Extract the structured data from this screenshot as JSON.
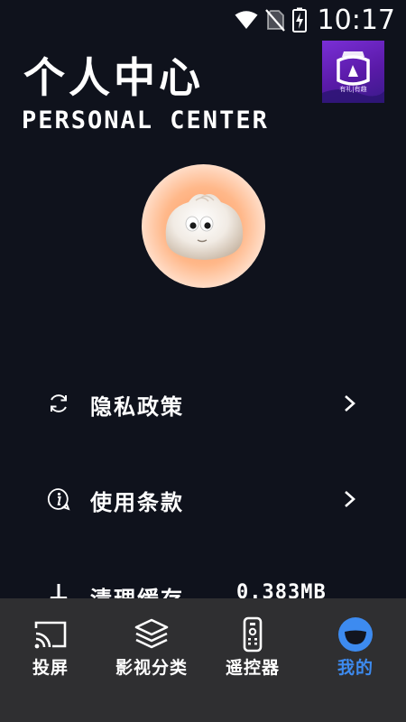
{
  "status_bar": {
    "time": "10:17",
    "icons": [
      "wifi-icon",
      "no-sim-icon",
      "battery-charging-icon"
    ]
  },
  "header": {
    "title": "个人中心",
    "subtitle": "PERSONAL CENTER",
    "logo_caption": "有礼|有趣"
  },
  "avatar": {
    "icon": "steamed-bun-avatar"
  },
  "menu": {
    "items": [
      {
        "label": "隐私政策",
        "icon": "refresh-icon",
        "arrow": "chevron-right-icon"
      },
      {
        "label": "使用条款",
        "icon": "info-icon",
        "arrow": "chevron-right-icon"
      },
      {
        "label": "清理缓存",
        "icon": "broom-icon",
        "value": "0.383MB"
      }
    ]
  },
  "bottom_nav": {
    "items": [
      {
        "label": "投屏",
        "icon": "cast-icon"
      },
      {
        "label": "影视分类",
        "icon": "layers-icon"
      },
      {
        "label": "遥控器",
        "icon": "remote-icon"
      },
      {
        "label": "我的",
        "icon": "profile-smile-icon",
        "active": true
      }
    ]
  },
  "colors": {
    "background": "#0f121c",
    "nav_background": "#2f2f31",
    "accent": "#3d8bf0"
  }
}
